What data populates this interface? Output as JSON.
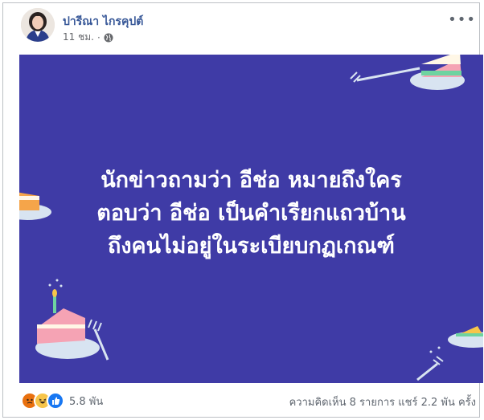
{
  "post": {
    "author": "ปารีณา ไกรคุปต์",
    "time": "11 ชม.",
    "separator": "·",
    "privacy_icon": "globe-icon",
    "more_icon": "more-options-icon"
  },
  "banner": {
    "background_color": "#3f3ba6",
    "lines": [
      "นักข่าวถามว่า อีช่อ หมายถึงใคร",
      "ตอบว่า อีช่อ เป็นคำเรียกแถวบ้าน",
      "ถึงคนไม่อยู่ในระเบียบกฏเกณฑ์"
    ]
  },
  "engagement": {
    "reactions": [
      "angry-reaction-icon",
      "haha-reaction-icon",
      "like-reaction-icon"
    ],
    "reaction_count": "5.8 พัน",
    "comments": "ความคิดเห็น 8 รายการ",
    "shares": "แชร์ 2.2 พัน ครั้ง"
  }
}
